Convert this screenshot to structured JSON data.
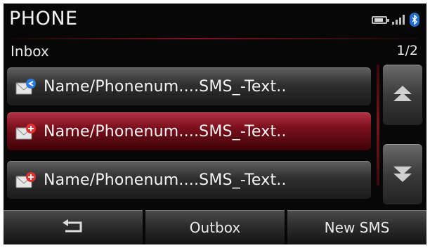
{
  "header": {
    "title": "PHONE",
    "status_icons": [
      "battery-icon",
      "signal-icon",
      "bluetooth-icon"
    ]
  },
  "subheader": {
    "folder": "Inbox",
    "page": "1/2"
  },
  "messages": [
    {
      "text": "Name/Phonenum....SMS_-Text..",
      "icon": "message-received-icon",
      "badge_color": "#2a7be0",
      "selected": false
    },
    {
      "text": "Name/Phonenum....SMS_-Text..",
      "icon": "message-unread-icon",
      "badge_color": "#e23030",
      "selected": true
    },
    {
      "text": "Name/Phonenum....SMS_-Text..",
      "icon": "message-unread-icon",
      "badge_color": "#e23030",
      "selected": false
    }
  ],
  "scroll": {
    "up_icon": "scroll-up-icon",
    "down_icon": "scroll-down-icon"
  },
  "bottom_bar": {
    "back_icon": "back-arrow-icon",
    "outbox": "Outbox",
    "new_sms": "New SMS"
  },
  "colors": {
    "accent_red": "#7a0f1c",
    "bluetooth_blue": "#1f6ed1"
  }
}
